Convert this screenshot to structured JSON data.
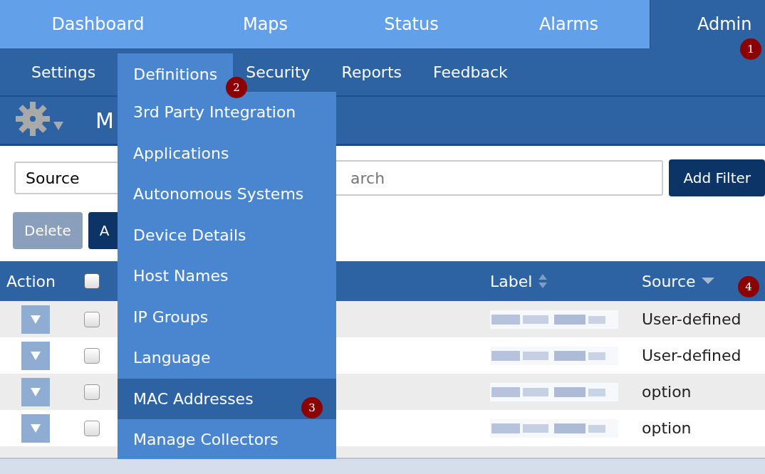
{
  "main_tabs": [
    {
      "label": "Dashboard",
      "selected": false
    },
    {
      "label": "Maps",
      "selected": false
    },
    {
      "label": "Status",
      "selected": false
    },
    {
      "label": "Alarms",
      "selected": false
    },
    {
      "label": "Admin",
      "selected": true
    }
  ],
  "sub_tabs": [
    {
      "label": "Settings",
      "selected": false
    },
    {
      "label": "Definitions",
      "selected": true
    },
    {
      "label": "Security",
      "selected": false
    },
    {
      "label": "Reports",
      "selected": false
    },
    {
      "label": "Feedback",
      "selected": false
    }
  ],
  "dropdown": [
    {
      "label": "3rd Party Integration",
      "selected": false
    },
    {
      "label": "Applications",
      "selected": false
    },
    {
      "label": "Autonomous Systems",
      "selected": false
    },
    {
      "label": "Device Details",
      "selected": false
    },
    {
      "label": "Host Names",
      "selected": false
    },
    {
      "label": "IP Groups",
      "selected": false
    },
    {
      "label": "Language",
      "selected": false
    },
    {
      "label": "MAC Addresses",
      "selected": true
    },
    {
      "label": "Manage Collectors",
      "selected": false
    }
  ],
  "page_title": "M",
  "filter": {
    "field": "Source",
    "search_placeholder": "arch",
    "button": "Add Filter"
  },
  "actions": [
    {
      "label": "Delete",
      "disabled": true
    },
    {
      "label": "A",
      "disabled": false
    }
  ],
  "table": {
    "columns": [
      {
        "label": "Action",
        "kind": "text"
      },
      {
        "kind": "checkbox",
        "checked": false
      },
      {
        "kind": "blank"
      },
      {
        "label": "Label",
        "kind": "sortable"
      },
      {
        "label": "Source",
        "kind": "sorted"
      }
    ],
    "rows": [
      {
        "checked": false,
        "source": "User-defined"
      },
      {
        "checked": false,
        "source": "User-defined"
      },
      {
        "checked": false,
        "source": "option"
      },
      {
        "checked": false,
        "source": "option"
      }
    ]
  },
  "callouts": [
    {
      "label": "1"
    },
    {
      "label": "2"
    },
    {
      "label": "3"
    },
    {
      "label": "4"
    }
  ]
}
